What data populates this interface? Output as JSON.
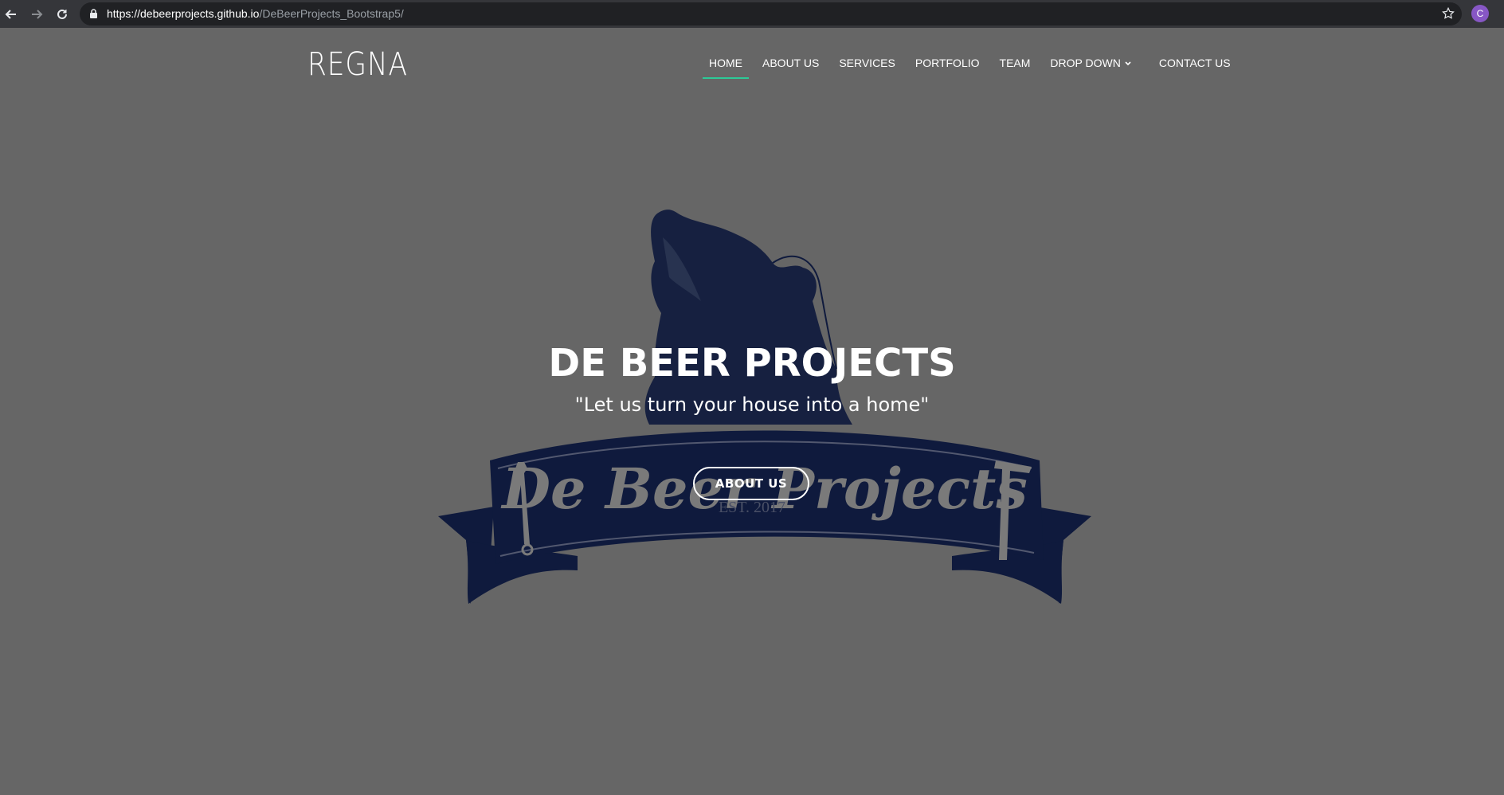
{
  "browser": {
    "url_host": "https://debeerprojects.github.io",
    "url_path": "/DeBeerProjects_Bootstrap5/",
    "profile_initial": "C"
  },
  "site": {
    "logo": "REGNA",
    "nav": [
      {
        "label": "HOME",
        "active": true
      },
      {
        "label": "ABOUT US"
      },
      {
        "label": "SERVICES"
      },
      {
        "label": "PORTFOLIO"
      },
      {
        "label": "TEAM"
      },
      {
        "label": "DROP DOWN",
        "dropdown": true
      },
      {
        "label": "CONTACT US"
      }
    ]
  },
  "hero": {
    "title": "DE BEER PROJECTS",
    "subtitle": "\"Let us turn your house into a home\"",
    "button": "ABOUT US",
    "banner_text": "De Beer Projects",
    "banner_est": "EST. 2017"
  },
  "colors": {
    "background": "#666666",
    "accent": "#2dc997",
    "logo_navy": "#0f1a3d"
  }
}
